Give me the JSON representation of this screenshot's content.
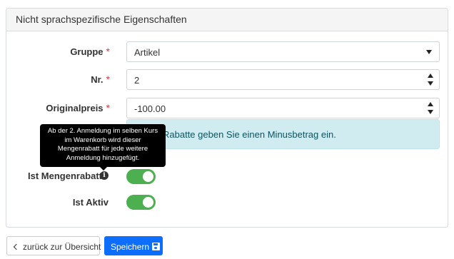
{
  "panel": {
    "title": "Nicht sprachspezifische Eigenschaften"
  },
  "form": {
    "gruppe": {
      "label": "Gruppe",
      "required_mark": "*",
      "value": "Artikel"
    },
    "nr": {
      "label": "Nr.",
      "required_mark": "*",
      "value": "2"
    },
    "originalpreis": {
      "label": "Originalpreis",
      "required_mark": "*",
      "value": "-100.00"
    },
    "hint": "Rabatte geben Sie einen Minusbetrag ein.",
    "tooltip": "Ab der 2. Anmeldung im selben Kurs im Warenkorb wird dieser Mengenrabatt für jede weitere Anmeldung hinzugefügt.",
    "mengenrabatt": {
      "label": "Ist Mengenrabatt",
      "info_icon": "i",
      "checked": true
    },
    "aktiv": {
      "label": "Ist Aktiv",
      "checked": true
    }
  },
  "actions": {
    "back_label": "zurück zur Übersicht",
    "save_label": "Speichern"
  },
  "colors": {
    "toggle_on": "#4caf50",
    "primary": "#0d6efd",
    "required": "#dc3545",
    "info_bg": "#d1ecf1"
  }
}
